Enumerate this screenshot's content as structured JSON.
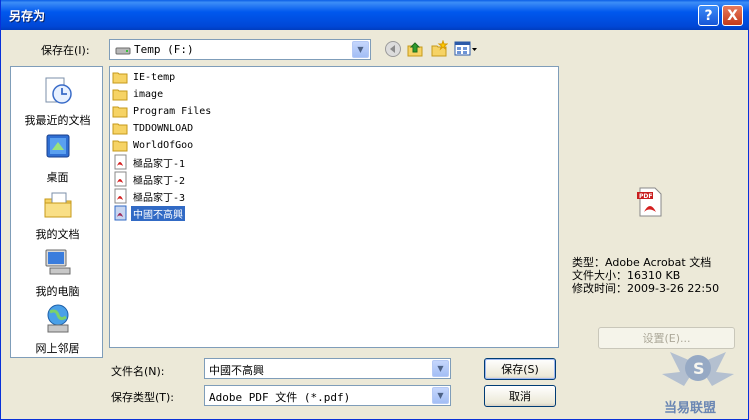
{
  "window": {
    "title": "另存为",
    "help_label": "?",
    "close_label": "X"
  },
  "save_in": {
    "label": "保存在(I):",
    "value": "Temp (F:)"
  },
  "places": [
    {
      "label": "我最近的文档",
      "icon": "recent-docs-icon"
    },
    {
      "label": "桌面",
      "icon": "desktop-icon"
    },
    {
      "label": "我的文档",
      "icon": "my-documents-icon"
    },
    {
      "label": "我的电脑",
      "icon": "my-computer-icon"
    },
    {
      "label": "网上邻居",
      "icon": "network-places-icon"
    }
  ],
  "files": [
    {
      "name": "IE-temp",
      "type": "folder"
    },
    {
      "name": "image",
      "type": "folder"
    },
    {
      "name": "Program Files",
      "type": "folder"
    },
    {
      "name": "TDDOWNLOAD",
      "type": "folder"
    },
    {
      "name": "WorldOfGoo",
      "type": "folder"
    },
    {
      "name": "極品家丁-1",
      "type": "pdf"
    },
    {
      "name": "極品家丁-2",
      "type": "pdf"
    },
    {
      "name": "極品家丁-3",
      "type": "pdf"
    },
    {
      "name": "中國不高興",
      "type": "pdf",
      "selected": true
    }
  ],
  "preview": {
    "type_line": "类型：Adobe Acrobat 文档",
    "size_line": "文件大小：16310 KB",
    "modified_line": "修改时间：2009-3-26 22:50",
    "settings_label": "设置(E)..."
  },
  "filename": {
    "label": "文件名(N):",
    "value": "中國不高興"
  },
  "filetype": {
    "label": "保存类型(T):",
    "value": "Adobe PDF 文件 (*.pdf)"
  },
  "buttons": {
    "save": "保存(S)",
    "cancel": "取消"
  },
  "watermark": {
    "text": "当易联盟"
  }
}
